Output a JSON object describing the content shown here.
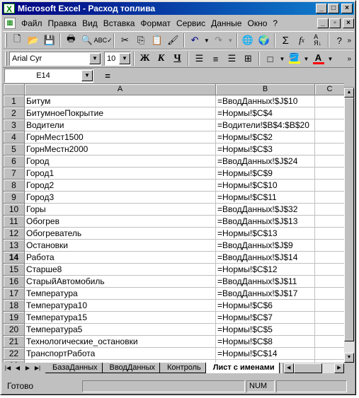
{
  "window": {
    "title": "Microsoft Excel - Расход топлива"
  },
  "menu": {
    "items": [
      "Файл",
      "Правка",
      "Вид",
      "Вставка",
      "Формат",
      "Сервис",
      "Данные",
      "Окно",
      "?"
    ]
  },
  "formatting": {
    "font_name": "Arial Cyr",
    "font_size": "10",
    "bold_label": "Ж",
    "italic_label": "К",
    "underline_label": "Ч"
  },
  "formula_bar": {
    "name_box": "E14",
    "equals": "=",
    "content": ""
  },
  "grid": {
    "columns": [
      "A",
      "B",
      "C"
    ],
    "active_row": 14,
    "rows": [
      {
        "n": "1",
        "a": "Битум",
        "b": "=ВводДанных!$J$10"
      },
      {
        "n": "2",
        "a": "БитумноеПокрытие",
        "b": "=Нормы!$C$4"
      },
      {
        "n": "3",
        "a": "Водители",
        "b": "=Водители!$B$4:$B$20"
      },
      {
        "n": "4",
        "a": "ГорнМест1500",
        "b": "=Нормы!$C$2"
      },
      {
        "n": "5",
        "a": "ГорнМестн2000",
        "b": "=Нормы!$C$3"
      },
      {
        "n": "6",
        "a": "Город",
        "b": "=ВводДанных!$J$24"
      },
      {
        "n": "7",
        "a": "Город1",
        "b": "=Нормы!$C$9"
      },
      {
        "n": "8",
        "a": "Город2",
        "b": "=Нормы!$C$10"
      },
      {
        "n": "9",
        "a": "Город3",
        "b": "=Нормы!$C$11"
      },
      {
        "n": "10",
        "a": "Горы",
        "b": "=ВводДанных!$J$32"
      },
      {
        "n": "11",
        "a": "Обогрев",
        "b": "=ВводДанных!$J$13"
      },
      {
        "n": "12",
        "a": "Обогреватель",
        "b": "=Нормы!$C$13"
      },
      {
        "n": "13",
        "a": "Остановки",
        "b": "=ВводДанных!$J$9"
      },
      {
        "n": "14",
        "a": "Работа",
        "b": "=ВводДанных!$J$14"
      },
      {
        "n": "15",
        "a": "Старше8",
        "b": "=Нормы!$C$12"
      },
      {
        "n": "16",
        "a": "СтарыйАвтомобиль",
        "b": "=ВводДанных!$J$11"
      },
      {
        "n": "17",
        "a": "Температура",
        "b": "=ВводДанных!$J$17"
      },
      {
        "n": "18",
        "a": "Температура10",
        "b": "=Нормы!$C$6"
      },
      {
        "n": "19",
        "a": "Температура15",
        "b": "=Нормы!$C$7"
      },
      {
        "n": "20",
        "a": "Температура5",
        "b": "=Нормы!$C$5"
      },
      {
        "n": "21",
        "a": "Технологические_остановки",
        "b": "=Нормы!$C$8"
      },
      {
        "n": "22",
        "a": "ТранспортРабота",
        "b": "=Нормы!$C$14"
      },
      {
        "n": "23",
        "a": "",
        "b": ""
      }
    ]
  },
  "sheet_tabs": {
    "tabs": [
      "БазаДанных",
      "ВводДанных",
      "Контроль",
      "Лист с именами"
    ],
    "active": "Лист с именами"
  },
  "status": {
    "text": "Готово",
    "num_indicator": "NUM"
  },
  "icons": [
    "new-icon",
    "open-icon",
    "save-icon",
    "print-icon",
    "print-preview-icon",
    "spelling-icon",
    "cut-icon",
    "copy-icon",
    "paste-icon",
    "format-painter-icon",
    "undo-icon",
    "redo-icon",
    "hyperlink-icon",
    "web-icon",
    "autosum-icon",
    "function-icon",
    "sort-ascending-icon",
    "help-icon"
  ],
  "colors": {
    "titlebar": "#000080",
    "chrome": "#c0c0c0",
    "fill_color": "#ffff00",
    "font_color": "#ff0000"
  }
}
